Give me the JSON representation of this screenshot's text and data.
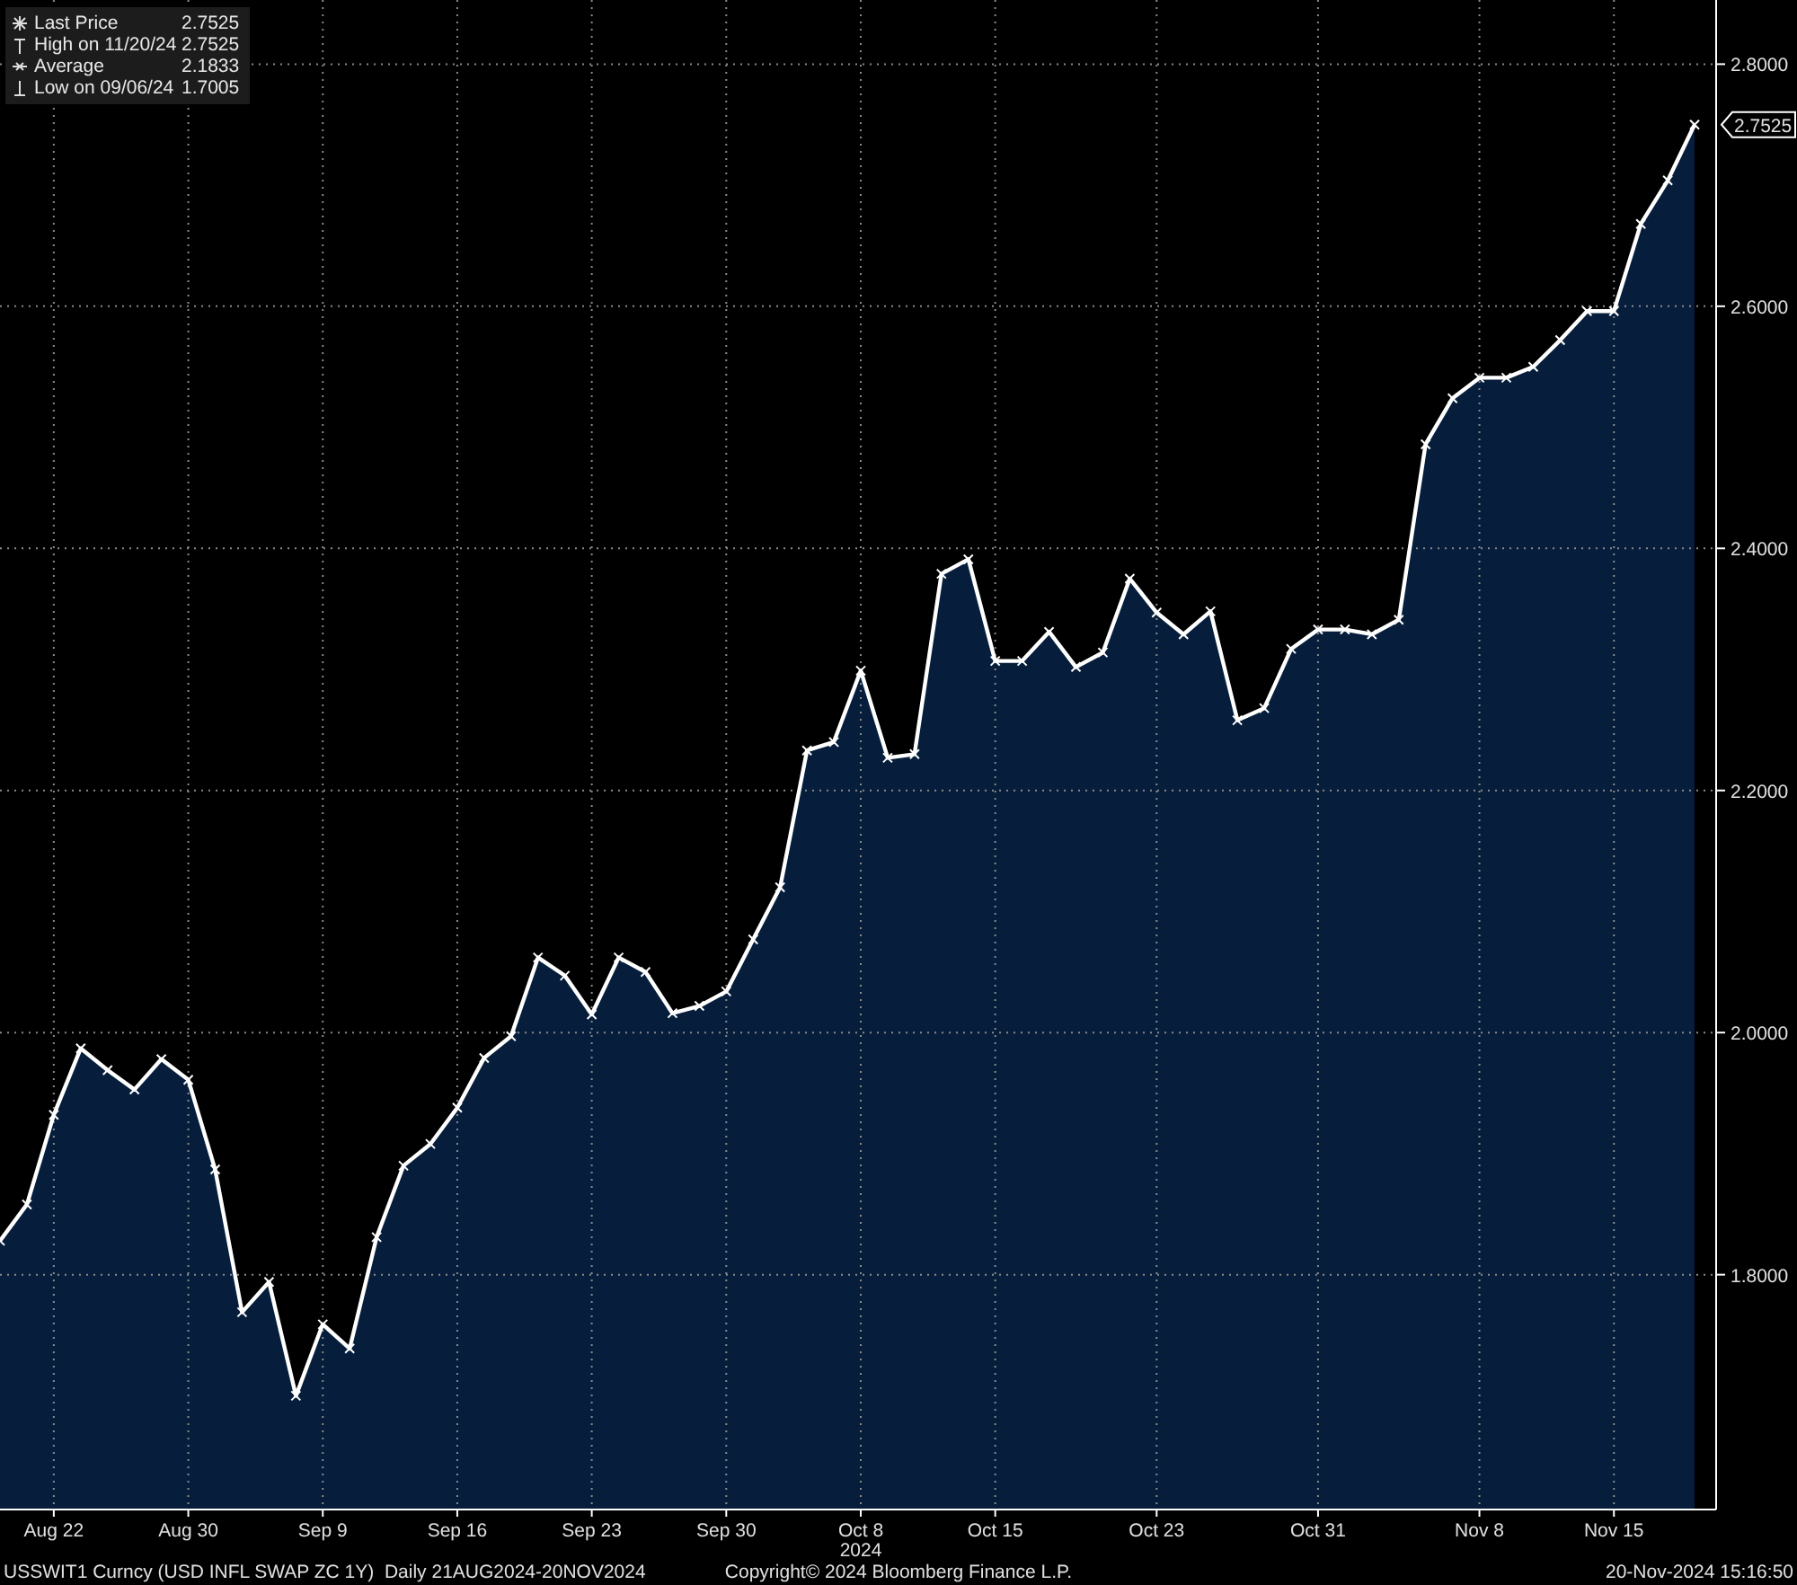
{
  "legend": [
    {
      "kind": "last",
      "value": "2.7525"
    },
    {
      "kind": "high",
      "label": "High on 11/20/24",
      "value": "2.7525"
    },
    {
      "kind": "average",
      "label": "Average",
      "value": "2.1833"
    },
    {
      "kind": "low",
      "label": "Low on 09/06/24",
      "value": "1.7005"
    }
  ],
  "last_price_tag": "2.7525",
  "chart_data": {
    "type": "area",
    "categories": [
      null,
      null,
      "Aug 22",
      null,
      null,
      null,
      null,
      "Aug 30",
      null,
      null,
      null,
      null,
      "Sep 9",
      null,
      null,
      null,
      null,
      "Sep 16",
      null,
      null,
      null,
      null,
      "Sep 23",
      null,
      null,
      null,
      null,
      "Sep 30",
      null,
      null,
      null,
      null,
      "Oct 8",
      null,
      null,
      null,
      null,
      "Oct 15",
      null,
      null,
      null,
      null,
      null,
      "Oct 23",
      null,
      null,
      null,
      null,
      null,
      "Oct 31",
      null,
      null,
      null,
      null,
      null,
      "Nov 8",
      null,
      null,
      null,
      null,
      "Nov 15",
      null,
      null,
      null
    ],
    "series": [
      {
        "name": "Last Price",
        "color": "#ffffff",
        "values": [
          1.828,
          1.858,
          1.932,
          1.987,
          1.969,
          1.953,
          1.978,
          1.961,
          1.887,
          1.769,
          1.794,
          1.7,
          1.759,
          1.739,
          1.831,
          1.89,
          1.908,
          1.938,
          1.979,
          1.997,
          2.062,
          2.047,
          2.015,
          2.062,
          2.05,
          2.016,
          2.022,
          2.034,
          2.077,
          2.12,
          2.233,
          2.24,
          2.299,
          2.227,
          2.23,
          2.379,
          2.391,
          2.307,
          2.307,
          2.331,
          2.302,
          2.314,
          2.375,
          2.347,
          2.329,
          2.348,
          2.258,
          2.268,
          2.317,
          2.333,
          2.333,
          2.329,
          2.341,
          2.486,
          2.524,
          2.541,
          2.541,
          2.55,
          2.572,
          2.596,
          2.596,
          2.668,
          2.704,
          2.75
        ]
      }
    ],
    "ylim": [
      1.606,
      2.853
    ],
    "yticks": [
      {
        "value": 1.8,
        "label": "1.8000"
      },
      {
        "value": 2.0,
        "label": "2.0000"
      },
      {
        "value": 2.2,
        "label": "2.2000"
      },
      {
        "value": 2.4,
        "label": "2.4000"
      },
      {
        "value": 2.6,
        "label": "2.6000"
      },
      {
        "value": 2.8,
        "label": "2.8000"
      }
    ],
    "grid": true,
    "annotations": [
      "2024"
    ]
  },
  "footer": {
    "series_description": "USSWIT1 Curncy (USD INFL SWAP ZC 1Y)  Daily 21AUG2024-20NOV2024",
    "copyright": "Copyright© 2024 Bloomberg Finance L.P.",
    "timestamp": "20-Nov-2024 15:16:50"
  }
}
